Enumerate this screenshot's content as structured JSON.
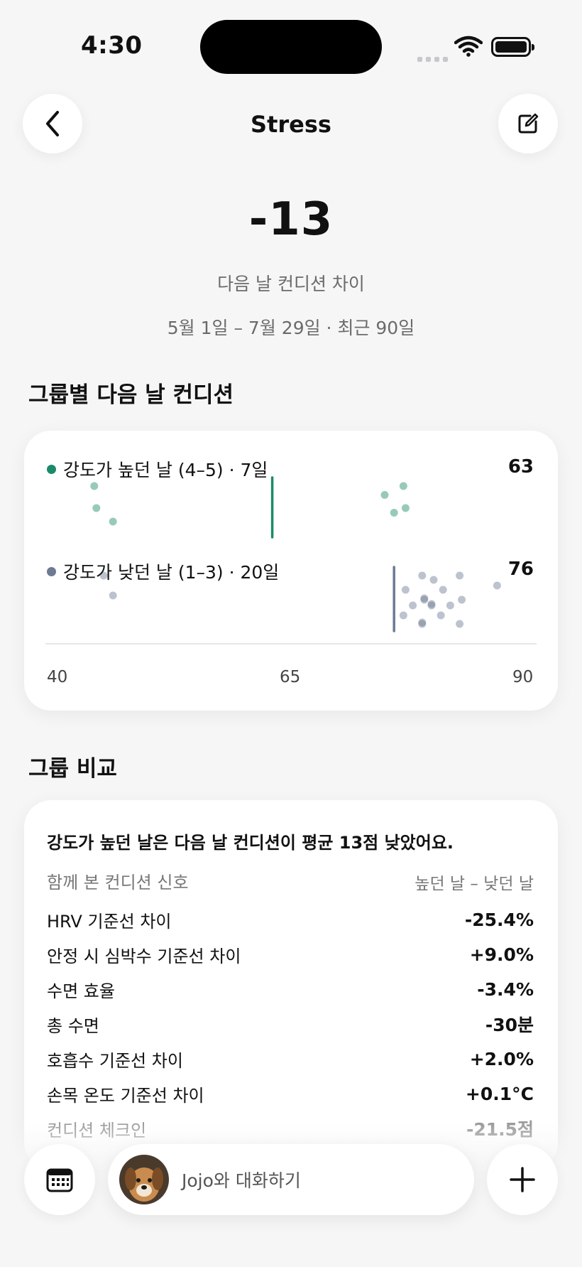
{
  "status": {
    "time": "4:30"
  },
  "nav": {
    "title": "Stress"
  },
  "hero": {
    "value": "-13",
    "caption": "다음 날 컨디션 차이",
    "range": "5월 1일 – 7월 29일 · 최근 90일"
  },
  "groups_section": {
    "title": "그룹별 다음 날 컨디션"
  },
  "chart_data": {
    "type": "scatter",
    "x_ticks": [
      "40",
      "65",
      "90"
    ],
    "xlim": [
      40,
      90
    ],
    "series": [
      {
        "name": "강도가 높던 날 (4–5) · 7일",
        "mean": 63,
        "color": "#1a8a6a",
        "points": [
          44,
          44,
          46,
          75,
          76,
          77,
          77
        ]
      },
      {
        "name": "강도가 낮던 날 (1–3) · 20일",
        "mean": 76,
        "color": "#6c7a93",
        "points": [
          45,
          46,
          77,
          77,
          78,
          79,
          79,
          79,
          79,
          80,
          80,
          80,
          81,
          81,
          82,
          83,
          83,
          83,
          87,
          79
        ]
      }
    ]
  },
  "compare_section": {
    "title": "그룹 비교"
  },
  "compare": {
    "headline": "강도가 높던 날은 다음 날 컨디션이 평균 13점 낮았어요.",
    "col_left": "함께 본 컨디션 신호",
    "col_right": "높던 날 – 낮던 날",
    "rows": [
      {
        "label": "HRV 기준선 차이",
        "value": "-25.4%"
      },
      {
        "label": "안정 시 심박수 기준선 차이",
        "value": "+9.0%"
      },
      {
        "label": "수면 효율",
        "value": "-3.4%"
      },
      {
        "label": "총 수면",
        "value": "-30분"
      },
      {
        "label": "호흡수 기준선 차이",
        "value": "+2.0%"
      },
      {
        "label": "손목 온도 기준선 차이",
        "value": "+0.1°C"
      },
      {
        "label": "컨디션 체크인",
        "value": "-21.5점"
      }
    ]
  },
  "chat": {
    "placeholder": "Jojo와 대화하기"
  }
}
